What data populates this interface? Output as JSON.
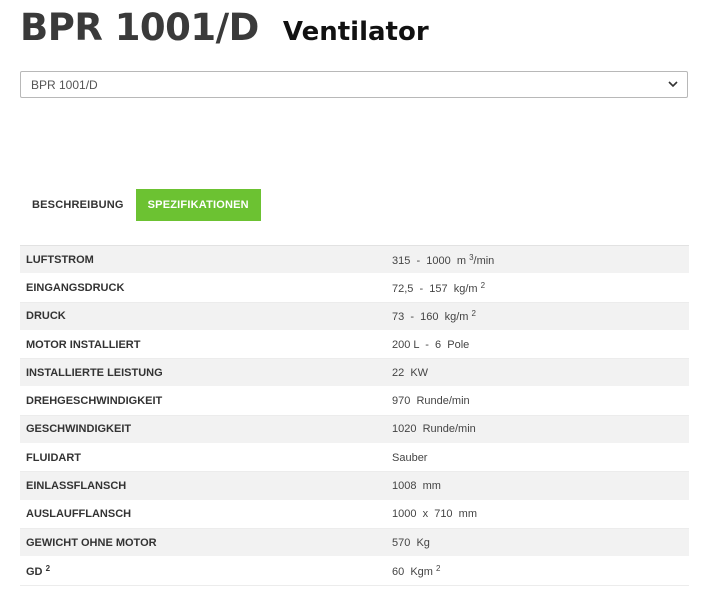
{
  "header": {
    "model": "BPR 1001/D",
    "type": "Ventilator"
  },
  "selector": {
    "value": "BPR 1001/D"
  },
  "tabs": [
    {
      "label": "BESCHREIBUNG",
      "active": false
    },
    {
      "label": "SPEZIFIKATIONEN",
      "active": true
    }
  ],
  "accent_color": "#6cc232",
  "specs": [
    {
      "label": "LUFTSTROM",
      "value": "315  -  1000  m",
      "sup": "3",
      "suffix": "/min"
    },
    {
      "label": "EINGANGSDRUCK",
      "value": "72,5  -  157  kg/m",
      "sup": "2",
      "suffix": ""
    },
    {
      "label": "DRUCK",
      "value": "73  -  160  kg/m",
      "sup": "2",
      "suffix": ""
    },
    {
      "label": "MOTOR INSTALLIERT",
      "value": "200 L  -  6  Pole",
      "sup": "",
      "suffix": ""
    },
    {
      "label": "INSTALLIERTE LEISTUNG",
      "value": "22  KW",
      "sup": "",
      "suffix": ""
    },
    {
      "label": "DREHGESCHWINDIGKEIT",
      "value": "970  Runde/min",
      "sup": "",
      "suffix": ""
    },
    {
      "label": "GESCHWINDIGKEIT",
      "value": "1020  Runde/min",
      "sup": "",
      "suffix": ""
    },
    {
      "label": "FLUIDART",
      "value": "Sauber",
      "sup": "",
      "suffix": ""
    },
    {
      "label": "EINLASSFLANSCH",
      "value": "1008  mm",
      "sup": "",
      "suffix": ""
    },
    {
      "label": "AUSLAUFFLANSCH",
      "value": "1000  x  710  mm",
      "sup": "",
      "suffix": ""
    },
    {
      "label": "GEWICHT OHNE MOTOR",
      "value": "570  Kg",
      "sup": "",
      "suffix": ""
    },
    {
      "label": "GD",
      "label_sup": "2",
      "value": "60  Kgm",
      "sup": "2",
      "suffix": ""
    }
  ]
}
